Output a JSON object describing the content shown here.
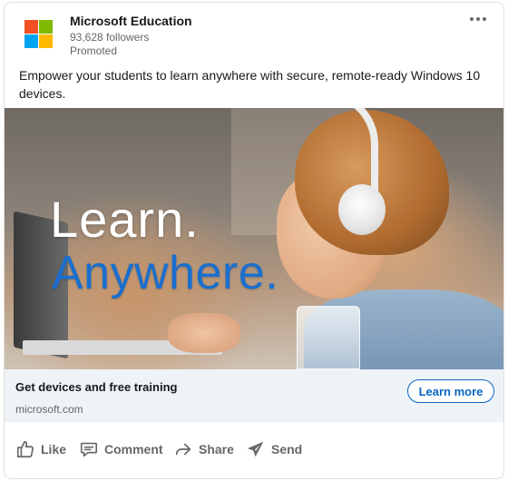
{
  "post": {
    "company_name": "Microsoft Education",
    "followers": "93,628 followers",
    "promoted_label": "Promoted",
    "text": "Empower your students to learn anywhere with secure, remote-ready Windows 10 devices."
  },
  "hero": {
    "line1": "Learn.",
    "line2": "Anywhere."
  },
  "cta": {
    "title": "Get devices and free training",
    "domain": "microsoft.com",
    "button_label": "Learn more"
  },
  "actions": [
    {
      "label": "Like",
      "icon": "thumbs-up-icon"
    },
    {
      "label": "Comment",
      "icon": "comment-icon"
    },
    {
      "label": "Share",
      "icon": "share-arrow-icon"
    },
    {
      "label": "Send",
      "icon": "send-icon"
    }
  ],
  "colors": {
    "accent": "#0a66c2",
    "hero_blue_text": "#1a6fce",
    "cta_background": "#eef3f8",
    "logo_red": "#f25022",
    "logo_green": "#7fba00",
    "logo_blue": "#00a4ef",
    "logo_yellow": "#ffb900"
  }
}
